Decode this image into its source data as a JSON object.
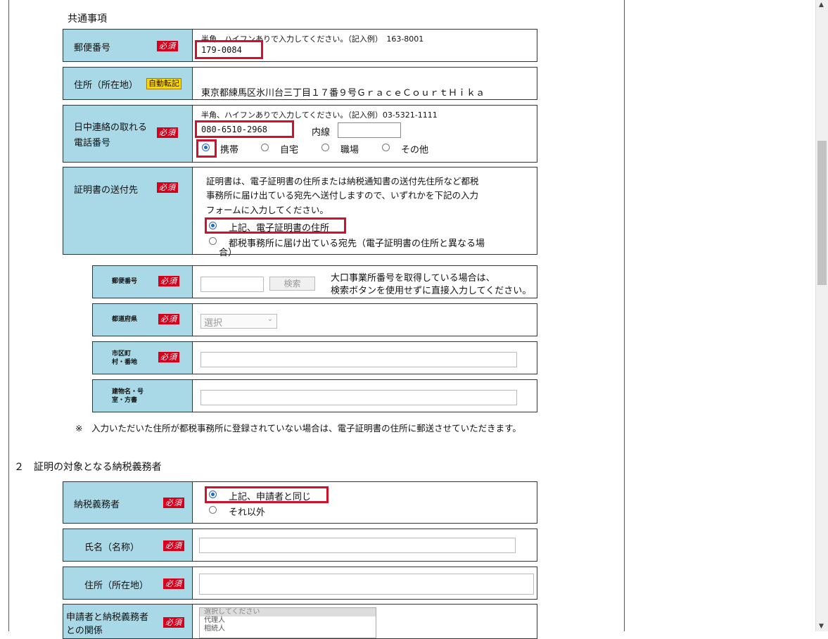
{
  "common": {
    "heading": "共通事項"
  },
  "postal": {
    "label": "郵便番号",
    "required": "必須",
    "hint": "半角、ハイフンありで入力してください。（記入例）　163-8001",
    "value": "179-0084"
  },
  "address": {
    "label": "住所（所在地）",
    "auto_badge": "自動転記",
    "value": "東京都練馬区氷川台三丁目１７番９号ＧｒａｃｅＣｏｕｒｔＨｉｋａ"
  },
  "phone": {
    "label_line1": "日中連絡の取れる",
    "label_line2": "電話番号",
    "required": "必須",
    "hint": "半角、ハイフンありで入力してください。（記入例）03-5321-1111",
    "value": "080-6510-2968",
    "ext_label": "内線",
    "ext_value": "",
    "options": [
      "携帯",
      "自宅",
      "職場",
      "その他"
    ],
    "selected": "携帯"
  },
  "delivery": {
    "label": "証明書の送付先",
    "required": "必須",
    "desc_line1": "証明書は、電子証明書の住所または納税通知書の送付先住所など都税",
    "desc_line2": "事務所に届け出ている宛先へ送付しますので、いずれかを下記の入力",
    "desc_line3": "フォームに入力してください。",
    "option1": "上記、電子証明書の住所",
    "option2": "都税事務所に届け出ている宛先（電子証明書の住所と異なる場",
    "option2_cont": "合）"
  },
  "sub_postal": {
    "label": "郵便番号",
    "required": "必須",
    "search_button": "検索",
    "note_line1": "大口事業所番号を取得している場合は、",
    "note_line2": "検索ボタンを使用せずに直接入力してください。"
  },
  "prefecture": {
    "label": "都道府県",
    "required": "必須",
    "select_value": "選択"
  },
  "city": {
    "label_line1": "市区町",
    "label_line2": "村・番地",
    "required": "必須"
  },
  "building": {
    "label_line1": "建物名・号",
    "label_line2": "室・方書"
  },
  "delivery_note": "※　入力いただいた住所が都税事務所に登録されていない場合は、電子証明書の住所に郵送させていただきます。",
  "section2": {
    "heading": "２　証明の対象となる納税義務者",
    "taxpayer": {
      "label": "納税義務者",
      "required": "必須",
      "option1": "上記、申請者と同じ",
      "option2": "それ以外"
    },
    "name": {
      "label": "氏名（名称）",
      "required": "必須"
    },
    "address": {
      "label": "住所（所在地）",
      "required": "必須"
    },
    "relation": {
      "label_line1": "申請者と納税義務者",
      "label_line2": "との関係",
      "required": "必須",
      "options": [
        "選択してください",
        "代理人",
        "相続人"
      ]
    }
  },
  "colors": {
    "label_bg": "#a9d8e6",
    "required_bg": "#d6001c",
    "highlight_border": "#d0112b",
    "auto_badge_bg": "#ffd700"
  }
}
